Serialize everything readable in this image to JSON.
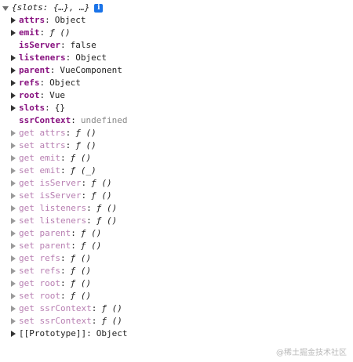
{
  "root": {
    "summary": "{slots: {…}, …}",
    "info_icon": "i"
  },
  "properties": [
    {
      "name": "attrs",
      "value": "Object",
      "expandable": true,
      "kind": "own"
    },
    {
      "name": "emit",
      "value": "ƒ ()",
      "expandable": true,
      "kind": "own",
      "func": true
    },
    {
      "name": "isServer",
      "value": "false",
      "expandable": false,
      "kind": "own"
    },
    {
      "name": "listeners",
      "value": "Object",
      "expandable": true,
      "kind": "own"
    },
    {
      "name": "parent",
      "value": "VueComponent",
      "expandable": true,
      "kind": "own"
    },
    {
      "name": "refs",
      "value": "Object",
      "expandable": true,
      "kind": "own"
    },
    {
      "name": "root",
      "value": "Vue",
      "expandable": true,
      "kind": "own"
    },
    {
      "name": "slots",
      "value": "{}",
      "expandable": true,
      "kind": "own"
    },
    {
      "name": "ssrContext",
      "value": "undefined",
      "expandable": false,
      "kind": "own",
      "undef": true
    },
    {
      "name": "get attrs",
      "value": "ƒ ()",
      "expandable": true,
      "kind": "accessor",
      "func": true
    },
    {
      "name": "set attrs",
      "value": "ƒ ()",
      "expandable": true,
      "kind": "accessor",
      "func": true
    },
    {
      "name": "get emit",
      "value": "ƒ ()",
      "expandable": true,
      "kind": "accessor",
      "func": true
    },
    {
      "name": "set emit",
      "value": "ƒ (_)",
      "expandable": true,
      "kind": "accessor",
      "func": true
    },
    {
      "name": "get isServer",
      "value": "ƒ ()",
      "expandable": true,
      "kind": "accessor",
      "func": true
    },
    {
      "name": "set isServer",
      "value": "ƒ ()",
      "expandable": true,
      "kind": "accessor",
      "func": true
    },
    {
      "name": "get listeners",
      "value": "ƒ ()",
      "expandable": true,
      "kind": "accessor",
      "func": true
    },
    {
      "name": "set listeners",
      "value": "ƒ ()",
      "expandable": true,
      "kind": "accessor",
      "func": true
    },
    {
      "name": "get parent",
      "value": "ƒ ()",
      "expandable": true,
      "kind": "accessor",
      "func": true
    },
    {
      "name": "set parent",
      "value": "ƒ ()",
      "expandable": true,
      "kind": "accessor",
      "func": true
    },
    {
      "name": "get refs",
      "value": "ƒ ()",
      "expandable": true,
      "kind": "accessor",
      "func": true
    },
    {
      "name": "set refs",
      "value": "ƒ ()",
      "expandable": true,
      "kind": "accessor",
      "func": true
    },
    {
      "name": "get root",
      "value": "ƒ ()",
      "expandable": true,
      "kind": "accessor",
      "func": true
    },
    {
      "name": "set root",
      "value": "ƒ ()",
      "expandable": true,
      "kind": "accessor",
      "func": true
    },
    {
      "name": "get ssrContext",
      "value": "ƒ ()",
      "expandable": true,
      "kind": "accessor",
      "func": true
    },
    {
      "name": "set ssrContext",
      "value": "ƒ ()",
      "expandable": true,
      "kind": "accessor",
      "func": true
    },
    {
      "name": "[[Prototype]]",
      "value": "Object",
      "expandable": true,
      "kind": "proto"
    }
  ],
  "watermark": "@稀土掘金技术社区",
  "colors": {
    "key": "#881280",
    "accessor_key": "#b87fb2",
    "undefined_value": "#888888",
    "info_icon": "#1a73e8"
  }
}
